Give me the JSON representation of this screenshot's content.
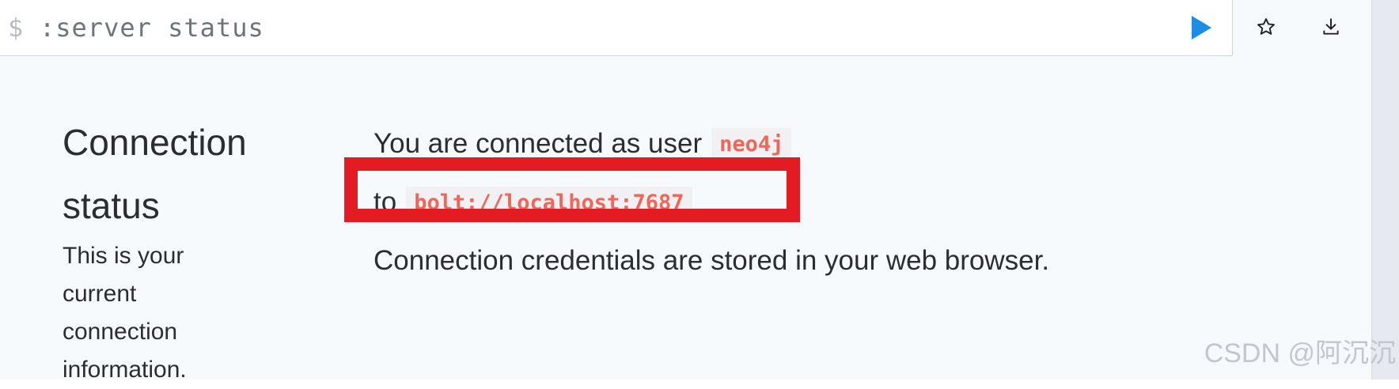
{
  "editor": {
    "prompt": "$",
    "command": ":server status",
    "run_icon": "play-icon"
  },
  "actions": {
    "favorite_icon": "star-icon",
    "download_icon": "download-icon"
  },
  "sidebar": {
    "title_line1": "Connection",
    "title_line2": "status",
    "description": "This is your current connection information."
  },
  "content": {
    "connected_prefix": "You are connected as user",
    "user": "neo4j",
    "to_prefix": "to",
    "address": "bolt://localhost:7687",
    "credentials_note": "Connection credentials are stored in your web browser."
  },
  "watermark": "CSDN @阿沉沉",
  "colors": {
    "accent_play": "#1a8ee6",
    "code_text": "#f0665a",
    "highlight_box": "#e31b23",
    "panel_bg": "#f7fafd"
  }
}
